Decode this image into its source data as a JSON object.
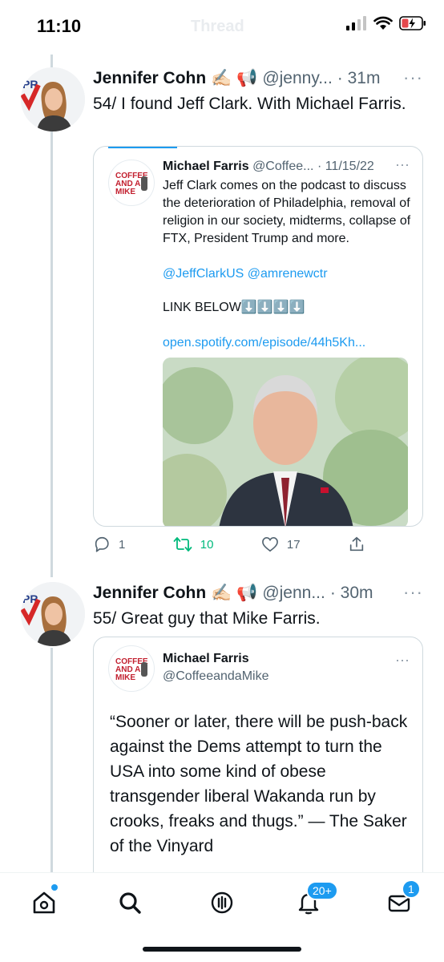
{
  "status_bar": {
    "time": "11:10",
    "faded_title": "Thread"
  },
  "tweets": [
    {
      "author": "Jennifer Cohn",
      "emoji": "✍🏻 📢",
      "handle": "@jenny...",
      "age": "· 31m",
      "text": "54/ I found Jeff Clark. With Michael Farris.",
      "quote": {
        "author": "Michael Farris",
        "meta": "@Coffee... · 11/15/22",
        "body": "Jeff Clark comes on the podcast to discuss the deterioration of Philadelphia, removal of religion in our society, midterms, collapse of FTX, President Trump and more.",
        "mentions": "@JeffClarkUS @amrenewctr",
        "link_below": "LINK BELOW⬇️⬇️⬇️⬇️",
        "url": "open.spotify.com/episode/44h5Kh..."
      },
      "actions": {
        "replies": "1",
        "retweets": "10",
        "likes": "17"
      }
    },
    {
      "author": "Jennifer Cohn",
      "emoji": "✍🏻 📢",
      "handle": "@jenn...",
      "age": "· 30m",
      "text": "55/ Great guy that Mike Farris.",
      "quote": {
        "author": "Michael Farris",
        "handle": "@CoffeeandaMike",
        "body": "“Sooner or later, there will be push-back against the Dems attempt to turn the USA into some kind of obese transgender liberal Wakanda run by crooks, freaks and thugs.” — The Saker of the Vinyard"
      }
    }
  ],
  "bottom_nav": {
    "notifications_badge": "20+",
    "messages_badge": "1"
  },
  "colors": {
    "accent": "#1d9bf0",
    "retweet": "#00ba7c",
    "text": "#0f1419",
    "muted": "#536471"
  }
}
